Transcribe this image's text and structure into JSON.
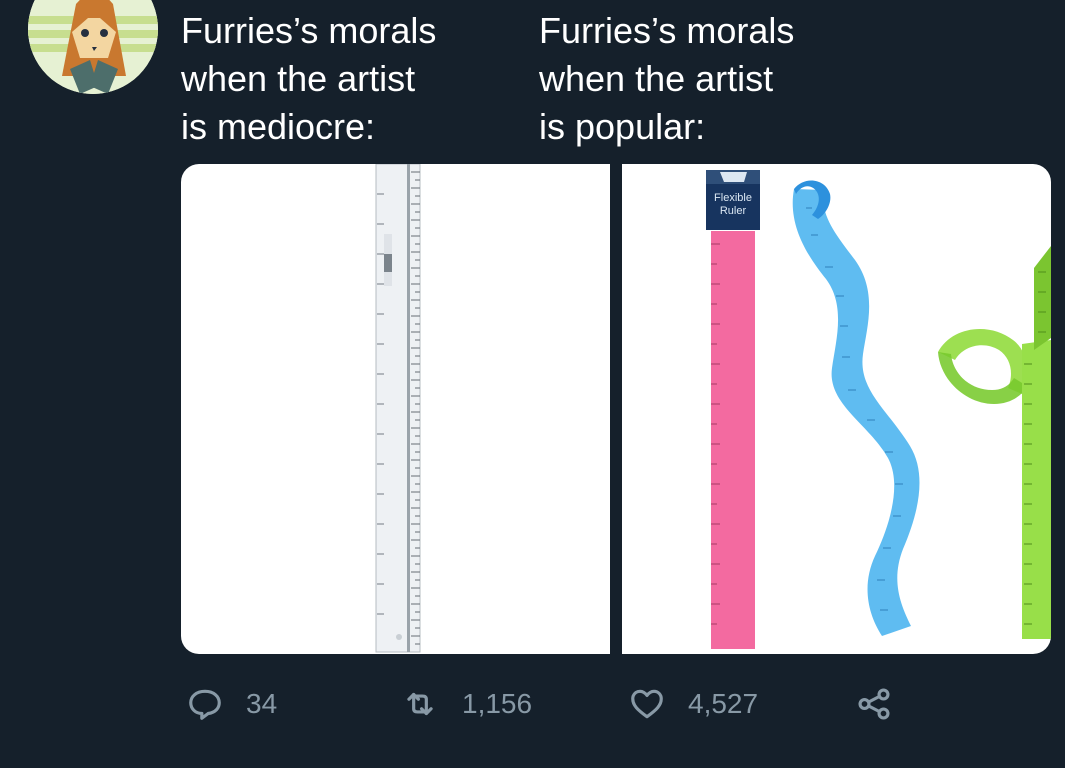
{
  "tweet": {
    "caption_left": "Furries’s morals\nwhen the artist\nis mediocre:",
    "caption_right": "Furries’s morals\nwhen the artist\nis popular:"
  },
  "media": {
    "left_image": "plain clear ruler",
    "right_image": {
      "package_label": "Flexible Ruler",
      "ruler_colors": [
        "#f06a9a",
        "#4fb6f0",
        "#8fd83b"
      ]
    }
  },
  "actions": {
    "replies": "34",
    "retweets": "1,156",
    "likes": "4,527"
  },
  "colors": {
    "background": "#15202b",
    "text": "#ffffff",
    "icon": "#8899a6"
  },
  "icons": [
    "reply-icon",
    "retweet-icon",
    "like-icon",
    "share-icon"
  ]
}
